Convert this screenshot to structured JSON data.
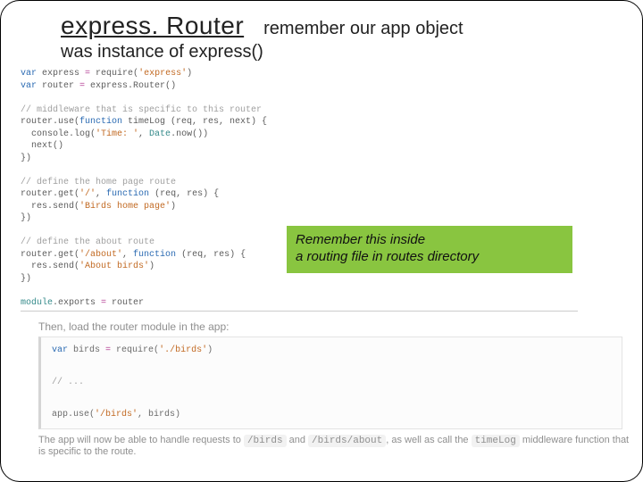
{
  "header": {
    "title": "express. Router",
    "right": "remember our app object",
    "subtitle": "was instance of express()"
  },
  "code1": {
    "l1a": "var",
    "l1b": " express ",
    "l1c": "=",
    "l1d": " require(",
    "l1e": "'express'",
    "l1f": ")",
    "l2a": "var",
    "l2b": " router ",
    "l2c": "=",
    "l2d": " express.Router()",
    "c1": "// middleware that is specific to this router",
    "m1a": "router.use(",
    "m1b": "function",
    "m1c": " timeLog (req, res, next) {",
    "m2a": "  console.log(",
    "m2b": "'Time: '",
    "m2c": ", ",
    "m2d": "Date",
    "m2e": ".now())",
    "m3": "  next()",
    "m4": "})",
    "c2": "// define the home page route",
    "h1a": "router.get(",
    "h1b": "'/'",
    "h1c": ", ",
    "h1d": "function",
    "h1e": " (req, res) {",
    "h2a": "  res.send(",
    "h2b": "'Birds home page'",
    "h2c": ")",
    "h3": "})",
    "c3": "// define the about route",
    "a1a": "router.get(",
    "a1b": "'/about'",
    "a1c": ", ",
    "a1d": "function",
    "a1e": " (req, res) {",
    "a2a": "  res.send(",
    "a2b": "'About birds'",
    "a2c": ")",
    "a3": "})",
    "e1a": "module",
    "e1b": ".exports ",
    "e1c": "=",
    "e1d": " router"
  },
  "callout": {
    "line1": "Remember this inside",
    "line2": "a routing file in routes directory"
  },
  "then_text": "Then, load the router module in the app:",
  "code2": {
    "l1a": "var",
    "l1b": " birds ",
    "l1c": "=",
    "l1d": " require(",
    "l1e": "'./birds'",
    "l1f": ")",
    "l2": "// ...",
    "l3a": "app.use(",
    "l3b": "'/birds'",
    "l3c": ", birds)"
  },
  "footnote": {
    "pre": "The app will now be able to handle requests to ",
    "c1": "/birds",
    "mid": " and ",
    "c2": "/birds/about",
    "mid2": ", as well as call the ",
    "c3": "timeLog",
    "post": " middleware function that is specific to the route."
  }
}
